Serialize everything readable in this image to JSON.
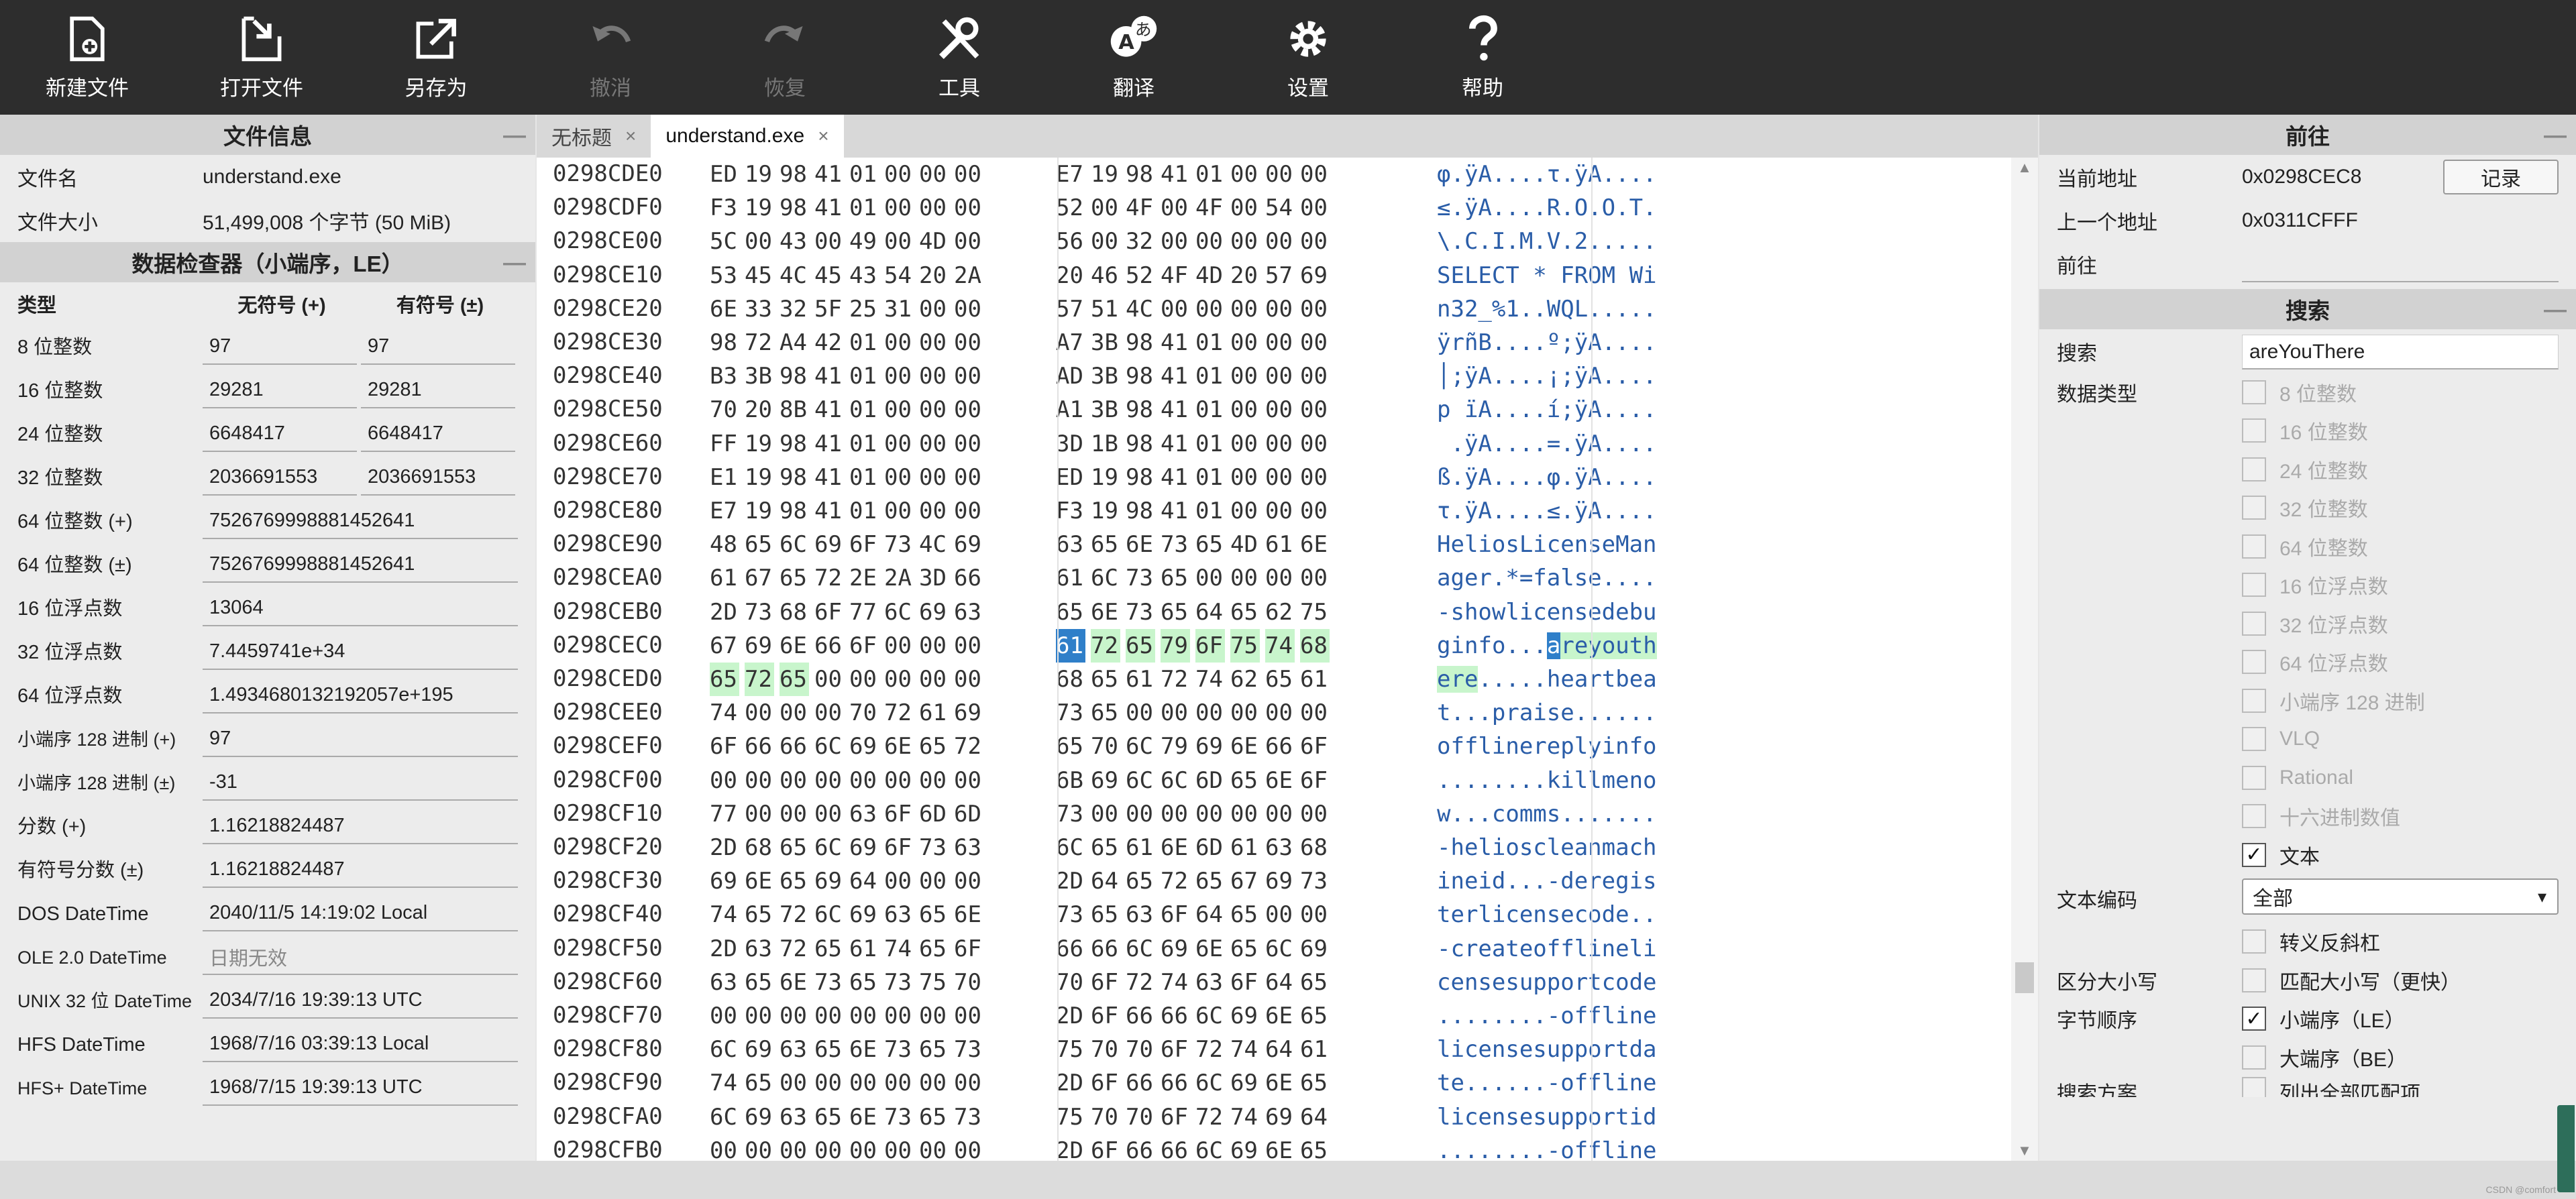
{
  "toolbar": {
    "new_file": "新建文件",
    "open_file": "打开文件",
    "save_as": "另存为",
    "undo": "撤消",
    "redo": "恢复",
    "tools": "工具",
    "translate": "翻译",
    "settings": "设置",
    "help": "帮助"
  },
  "file_info": {
    "title": "文件信息",
    "name_label": "文件名",
    "name_value": "understand.exe",
    "size_label": "文件大小",
    "size_value": "51,499,008 个字节 (50 MiB)"
  },
  "inspector": {
    "title": "数据检查器（小端序，LE）",
    "col_type": "类型",
    "col_unsigned": "无符号 (+)",
    "col_signed": "有符号 (±)",
    "rows": [
      {
        "label": "8 位整数",
        "u": "97",
        "s": "97"
      },
      {
        "label": "16 位整数",
        "u": "29281",
        "s": "29281"
      },
      {
        "label": "24 位整数",
        "u": "6648417",
        "s": "6648417"
      },
      {
        "label": "32 位整数",
        "u": "2036691553",
        "s": "2036691553"
      }
    ],
    "wide_rows": [
      {
        "label": "64 位整数 (+)",
        "v": "7526769998881452641"
      },
      {
        "label": "64 位整数 (±)",
        "v": "7526769998881452641"
      },
      {
        "label": "16 位浮点数",
        "v": "13064"
      },
      {
        "label": "32 位浮点数",
        "v": "7.4459741e+34"
      },
      {
        "label": "64 位浮点数",
        "v": "1.4934680132192057e+195"
      },
      {
        "label": "小端序 128 进制 (+)",
        "v": "97"
      },
      {
        "label": "小端序 128 进制 (±)",
        "v": "-31"
      },
      {
        "label": "分数 (+)",
        "v": "1.16218824487"
      },
      {
        "label": "有符号分数 (±)",
        "v": "1.16218824487"
      },
      {
        "label": "DOS DateTime",
        "v": "2040/11/5 14:19:02 Local"
      },
      {
        "label": "OLE 2.0 DateTime",
        "v": "日期无效"
      },
      {
        "label": "UNIX 32 位 DateTime",
        "v": "2034/7/16 19:39:13 UTC"
      },
      {
        "label": "HFS DateTime",
        "v": "1968/7/16 03:39:13 Local"
      },
      {
        "label": "HFS+ DateTime",
        "v": "1968/7/15 19:39:13 UTC"
      }
    ]
  },
  "tabs": [
    {
      "label": "无标题",
      "close": "×"
    },
    {
      "label": "understand.exe",
      "close": "×"
    }
  ],
  "hex": {
    "rows": [
      {
        "addr": "0298CDE0",
        "bytes": [
          "ED",
          "19",
          "98",
          "41",
          "01",
          "00",
          "00",
          "00",
          "E7",
          "19",
          "98",
          "41",
          "01",
          "00",
          "00",
          "00"
        ],
        "ascii": "φ.ÿA....τ.ÿA...."
      },
      {
        "addr": "0298CDF0",
        "bytes": [
          "F3",
          "19",
          "98",
          "41",
          "01",
          "00",
          "00",
          "00",
          "52",
          "00",
          "4F",
          "00",
          "4F",
          "00",
          "54",
          "00"
        ],
        "ascii": "≤.ÿA....R.O.O.T."
      },
      {
        "addr": "0298CE00",
        "bytes": [
          "5C",
          "00",
          "43",
          "00",
          "49",
          "00",
          "4D",
          "00",
          "56",
          "00",
          "32",
          "00",
          "00",
          "00",
          "00",
          "00"
        ],
        "ascii": "\\.C.I.M.V.2....."
      },
      {
        "addr": "0298CE10",
        "bytes": [
          "53",
          "45",
          "4C",
          "45",
          "43",
          "54",
          "20",
          "2A",
          "20",
          "46",
          "52",
          "4F",
          "4D",
          "20",
          "57",
          "69"
        ],
        "ascii": "SELECT * FROM Wi"
      },
      {
        "addr": "0298CE20",
        "bytes": [
          "6E",
          "33",
          "32",
          "5F",
          "25",
          "31",
          "00",
          "00",
          "57",
          "51",
          "4C",
          "00",
          "00",
          "00",
          "00",
          "00"
        ],
        "ascii": "n32_%1..WQL....."
      },
      {
        "addr": "0298CE30",
        "bytes": [
          "98",
          "72",
          "A4",
          "42",
          "01",
          "00",
          "00",
          "00",
          "A7",
          "3B",
          "98",
          "41",
          "01",
          "00",
          "00",
          "00"
        ],
        "ascii": "ÿrñB....º;ÿA...."
      },
      {
        "addr": "0298CE40",
        "bytes": [
          "B3",
          "3B",
          "98",
          "41",
          "01",
          "00",
          "00",
          "00",
          "AD",
          "3B",
          "98",
          "41",
          "01",
          "00",
          "00",
          "00"
        ],
        "ascii": "│;ÿA....¡;ÿA...."
      },
      {
        "addr": "0298CE50",
        "bytes": [
          "70",
          "20",
          "8B",
          "41",
          "01",
          "00",
          "00",
          "00",
          "A1",
          "3B",
          "98",
          "41",
          "01",
          "00",
          "00",
          "00"
        ],
        "ascii": "p ïA....í;ÿA...."
      },
      {
        "addr": "0298CE60",
        "bytes": [
          "FF",
          "19",
          "98",
          "41",
          "01",
          "00",
          "00",
          "00",
          "3D",
          "1B",
          "98",
          "41",
          "01",
          "00",
          "00",
          "00"
        ],
        "ascii": " .ÿA....=.ÿA...."
      },
      {
        "addr": "0298CE70",
        "bytes": [
          "E1",
          "19",
          "98",
          "41",
          "01",
          "00",
          "00",
          "00",
          "ED",
          "19",
          "98",
          "41",
          "01",
          "00",
          "00",
          "00"
        ],
        "ascii": "ß.ÿA....φ.ÿA...."
      },
      {
        "addr": "0298CE80",
        "bytes": [
          "E7",
          "19",
          "98",
          "41",
          "01",
          "00",
          "00",
          "00",
          "F3",
          "19",
          "98",
          "41",
          "01",
          "00",
          "00",
          "00"
        ],
        "ascii": "τ.ÿA....≤.ÿA...."
      },
      {
        "addr": "0298CE90",
        "bytes": [
          "48",
          "65",
          "6C",
          "69",
          "6F",
          "73",
          "4C",
          "69",
          "63",
          "65",
          "6E",
          "73",
          "65",
          "4D",
          "61",
          "6E"
        ],
        "ascii": "HeliosLicenseMan"
      },
      {
        "addr": "0298CEA0",
        "bytes": [
          "61",
          "67",
          "65",
          "72",
          "2E",
          "2A",
          "3D",
          "66",
          "61",
          "6C",
          "73",
          "65",
          "00",
          "00",
          "00",
          "00"
        ],
        "ascii": "ager.*=false...."
      },
      {
        "addr": "0298CEB0",
        "bytes": [
          "2D",
          "73",
          "68",
          "6F",
          "77",
          "6C",
          "69",
          "63",
          "65",
          "6E",
          "73",
          "65",
          "64",
          "65",
          "62",
          "75"
        ],
        "ascii": "-showlicensedebu"
      },
      {
        "addr": "0298CEC0",
        "bytes": [
          "67",
          "69",
          "6E",
          "66",
          "6F",
          "00",
          "00",
          "00",
          "61",
          "72",
          "65",
          "79",
          "6F",
          "75",
          "74",
          "68"
        ],
        "ascii": "ginfo...areyouth"
      },
      {
        "addr": "0298CED0",
        "bytes": [
          "65",
          "72",
          "65",
          "00",
          "00",
          "00",
          "00",
          "00",
          "68",
          "65",
          "61",
          "72",
          "74",
          "62",
          "65",
          "61"
        ],
        "ascii": "ere.....heartbea"
      },
      {
        "addr": "0298CEE0",
        "bytes": [
          "74",
          "00",
          "00",
          "00",
          "70",
          "72",
          "61",
          "69",
          "73",
          "65",
          "00",
          "00",
          "00",
          "00",
          "00",
          "00"
        ],
        "ascii": "t...praise......"
      },
      {
        "addr": "0298CEF0",
        "bytes": [
          "6F",
          "66",
          "66",
          "6C",
          "69",
          "6E",
          "65",
          "72",
          "65",
          "70",
          "6C",
          "79",
          "69",
          "6E",
          "66",
          "6F"
        ],
        "ascii": "offlinereplyinfo"
      },
      {
        "addr": "0298CF00",
        "bytes": [
          "00",
          "00",
          "00",
          "00",
          "00",
          "00",
          "00",
          "00",
          "6B",
          "69",
          "6C",
          "6C",
          "6D",
          "65",
          "6E",
          "6F"
        ],
        "ascii": "........killmeno"
      },
      {
        "addr": "0298CF10",
        "bytes": [
          "77",
          "00",
          "00",
          "00",
          "63",
          "6F",
          "6D",
          "6D",
          "73",
          "00",
          "00",
          "00",
          "00",
          "00",
          "00",
          "00"
        ],
        "ascii": "w...comms......."
      },
      {
        "addr": "0298CF20",
        "bytes": [
          "2D",
          "68",
          "65",
          "6C",
          "69",
          "6F",
          "73",
          "63",
          "6C",
          "65",
          "61",
          "6E",
          "6D",
          "61",
          "63",
          "68"
        ],
        "ascii": "-helioscleanmach"
      },
      {
        "addr": "0298CF30",
        "bytes": [
          "69",
          "6E",
          "65",
          "69",
          "64",
          "00",
          "00",
          "00",
          "2D",
          "64",
          "65",
          "72",
          "65",
          "67",
          "69",
          "73"
        ],
        "ascii": "ineid...-deregis"
      },
      {
        "addr": "0298CF40",
        "bytes": [
          "74",
          "65",
          "72",
          "6C",
          "69",
          "63",
          "65",
          "6E",
          "73",
          "65",
          "63",
          "6F",
          "64",
          "65",
          "00",
          "00"
        ],
        "ascii": "terlicensecode.."
      },
      {
        "addr": "0298CF50",
        "bytes": [
          "2D",
          "63",
          "72",
          "65",
          "61",
          "74",
          "65",
          "6F",
          "66",
          "66",
          "6C",
          "69",
          "6E",
          "65",
          "6C",
          "69"
        ],
        "ascii": "-createofflineli"
      },
      {
        "addr": "0298CF60",
        "bytes": [
          "63",
          "65",
          "6E",
          "73",
          "65",
          "73",
          "75",
          "70",
          "70",
          "6F",
          "72",
          "74",
          "63",
          "6F",
          "64",
          "65"
        ],
        "ascii": "censesupportcode"
      },
      {
        "addr": "0298CF70",
        "bytes": [
          "00",
          "00",
          "00",
          "00",
          "00",
          "00",
          "00",
          "00",
          "2D",
          "6F",
          "66",
          "66",
          "6C",
          "69",
          "6E",
          "65"
        ],
        "ascii": "........-offline"
      },
      {
        "addr": "0298CF80",
        "bytes": [
          "6C",
          "69",
          "63",
          "65",
          "6E",
          "73",
          "65",
          "73",
          "75",
          "70",
          "70",
          "6F",
          "72",
          "74",
          "64",
          "61"
        ],
        "ascii": "licensesupportda"
      },
      {
        "addr": "0298CF90",
        "bytes": [
          "74",
          "65",
          "00",
          "00",
          "00",
          "00",
          "00",
          "00",
          "2D",
          "6F",
          "66",
          "66",
          "6C",
          "69",
          "6E",
          "65"
        ],
        "ascii": "te......-offline"
      },
      {
        "addr": "0298CFA0",
        "bytes": [
          "6C",
          "69",
          "63",
          "65",
          "6E",
          "73",
          "65",
          "73",
          "75",
          "70",
          "70",
          "6F",
          "72",
          "74",
          "69",
          "64"
        ],
        "ascii": "licensesupportid"
      },
      {
        "addr": "0298CFB0",
        "bytes": [
          "00",
          "00",
          "00",
          "00",
          "00",
          "00",
          "00",
          "00",
          "2D",
          "6F",
          "66",
          "66",
          "6C",
          "69",
          "6E",
          "65"
        ],
        "ascii": "........-offline"
      }
    ]
  },
  "goto": {
    "title": "前往",
    "current_label": "当前地址",
    "current_value": "0x0298CEC8",
    "record_button": "记录",
    "prev_label": "上一个地址",
    "prev_value": "0x0311CFFF",
    "goto_label": "前往",
    "goto_value": ""
  },
  "search": {
    "title": "搜索",
    "search_label": "搜索",
    "search_value": "areYouThere",
    "datatype_label": "数据类型",
    "datatypes": [
      {
        "label": "8 位整数",
        "checked": false
      },
      {
        "label": "16 位整数",
        "checked": false
      },
      {
        "label": "24 位整数",
        "checked": false
      },
      {
        "label": "32 位整数",
        "checked": false
      },
      {
        "label": "64 位整数",
        "checked": false
      },
      {
        "label": "16 位浮点数",
        "checked": false
      },
      {
        "label": "32 位浮点数",
        "checked": false
      },
      {
        "label": "64 位浮点数",
        "checked": false
      },
      {
        "label": "小端序 128 进制",
        "checked": false
      },
      {
        "label": "VLQ",
        "checked": false
      },
      {
        "label": "Rational",
        "checked": false
      },
      {
        "label": "十六进制数值",
        "checked": false
      },
      {
        "label": "文本",
        "checked": true
      }
    ],
    "encoding_label": "文本编码",
    "encoding_value": "全部",
    "escape_label": "转义反斜杠",
    "case_label": "区分大小写",
    "case_option": "匹配大小写（更快）",
    "byteorder_label": "字节顺序",
    "le_option": "小端序（LE）",
    "be_option": "大端序（BE）",
    "scheme_label": "搜索方案",
    "scheme_option": "列出全部匹配项",
    "checkmark": "✓"
  },
  "status": {
    "watermark": "CSDN @comfort"
  }
}
